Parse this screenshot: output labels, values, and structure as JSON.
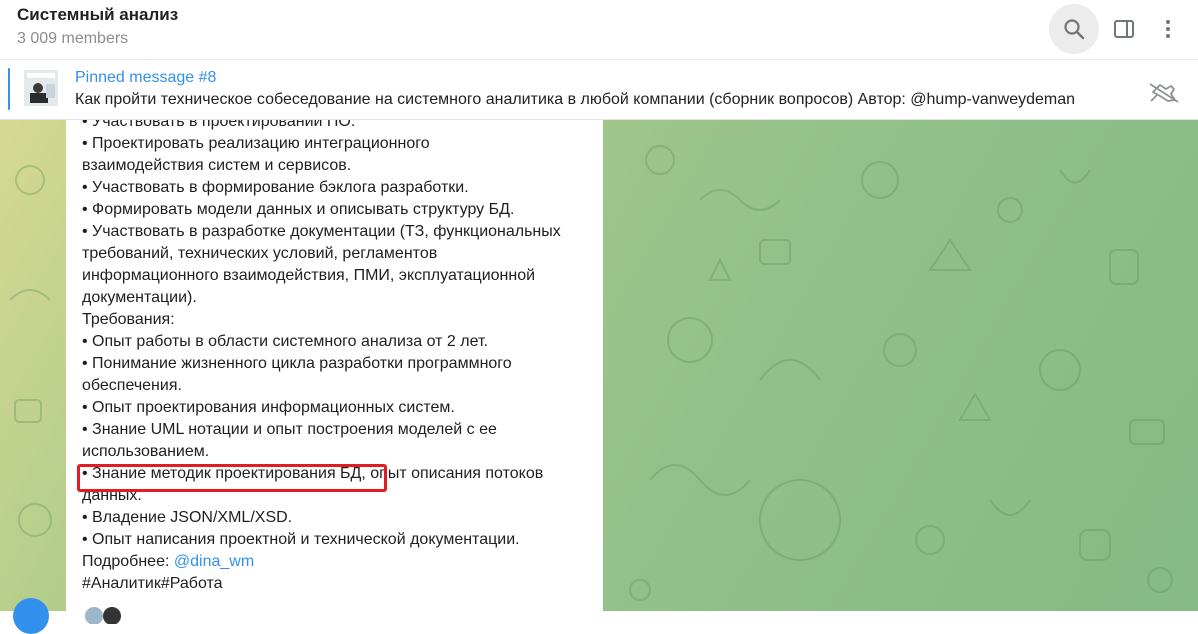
{
  "header": {
    "title": "Системный анализ",
    "subtitle": "3 009 members",
    "icons": [
      "search-icon",
      "sidebar-toggle-icon",
      "more-vertical-icon"
    ]
  },
  "pinned": {
    "title": "Pinned message #8",
    "text": "Как пройти техническое собеседование на системного аналитика в любой компании (сборник вопросов)  Автор: @hump-vanweydeman",
    "icon": "unpin-icon"
  },
  "message": {
    "lines": [
      "• Участвовать в проектировании ПО.",
      "• Проектировать реализацию интеграционного",
      "взаимодействия систем и сервисов.",
      "• Участвовать в формирование бэклога разработки.",
      "• Формировать модели данных и описывать структуру БД.",
      "• Участвовать в разработке документации (ТЗ, функциональных",
      "требований, технических условий, регламентов",
      "информационного взаимодействия, ПМИ, эксплуатационной",
      "документации).",
      "Требования:",
      "• Опыт работы в области системного анализа от 2 лет.",
      "• Понимание жизненного цикла разработки программного",
      "обеспечения.",
      "• Опыт проектирования информационных систем.",
      "• Знание UML нотации и опыт построения моделей с ее",
      "использованием.",
      "• Знание методик проектирования БД, опыт описания потоков",
      "данных.",
      "• Владение JSON/XML/XSD.",
      "• Опыт написания проектной и технической документации."
    ],
    "more_prefix": "Подробнее: ",
    "mention": "@dina_wm",
    "hashtags": "#Аналитик#Работа"
  },
  "colors": {
    "accent": "#3390ec",
    "highlight": "#e31b23"
  }
}
